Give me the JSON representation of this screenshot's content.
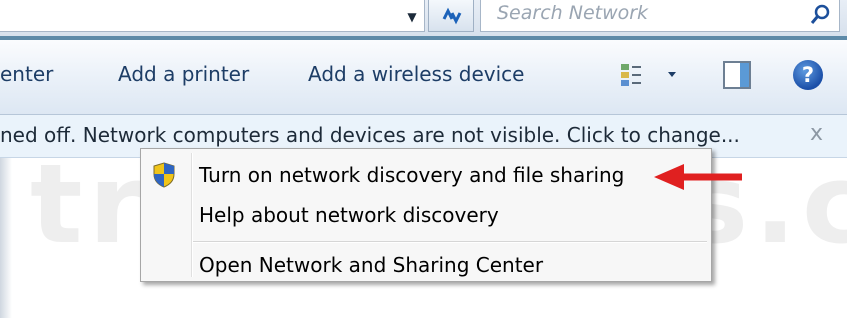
{
  "toolbar": {
    "search_placeholder": "Search Network",
    "items": [
      {
        "label": "enter"
      },
      {
        "label": "Add a printer"
      },
      {
        "label": "Add a wireless device"
      }
    ]
  },
  "infobar": {
    "message": "ned off. Network computers and devices are not visible. Click to change...",
    "close_label": "x"
  },
  "context_menu": {
    "items": [
      {
        "label": "Turn on network discovery and file sharing"
      },
      {
        "label": "Help about network discovery"
      },
      {
        "label": "Open Network and Sharing Center"
      }
    ]
  },
  "watermark": "trickyways.com",
  "colors": {
    "accent_arrow": "#e02020",
    "infobar_bg": "#eaf3fb",
    "command_text": "#1d3d66"
  },
  "icons": [
    "dropdown-icon",
    "refresh-icon",
    "search-icon",
    "views-icon",
    "preview-pane-icon",
    "help-icon",
    "shield-icon",
    "arrow-icon"
  ]
}
